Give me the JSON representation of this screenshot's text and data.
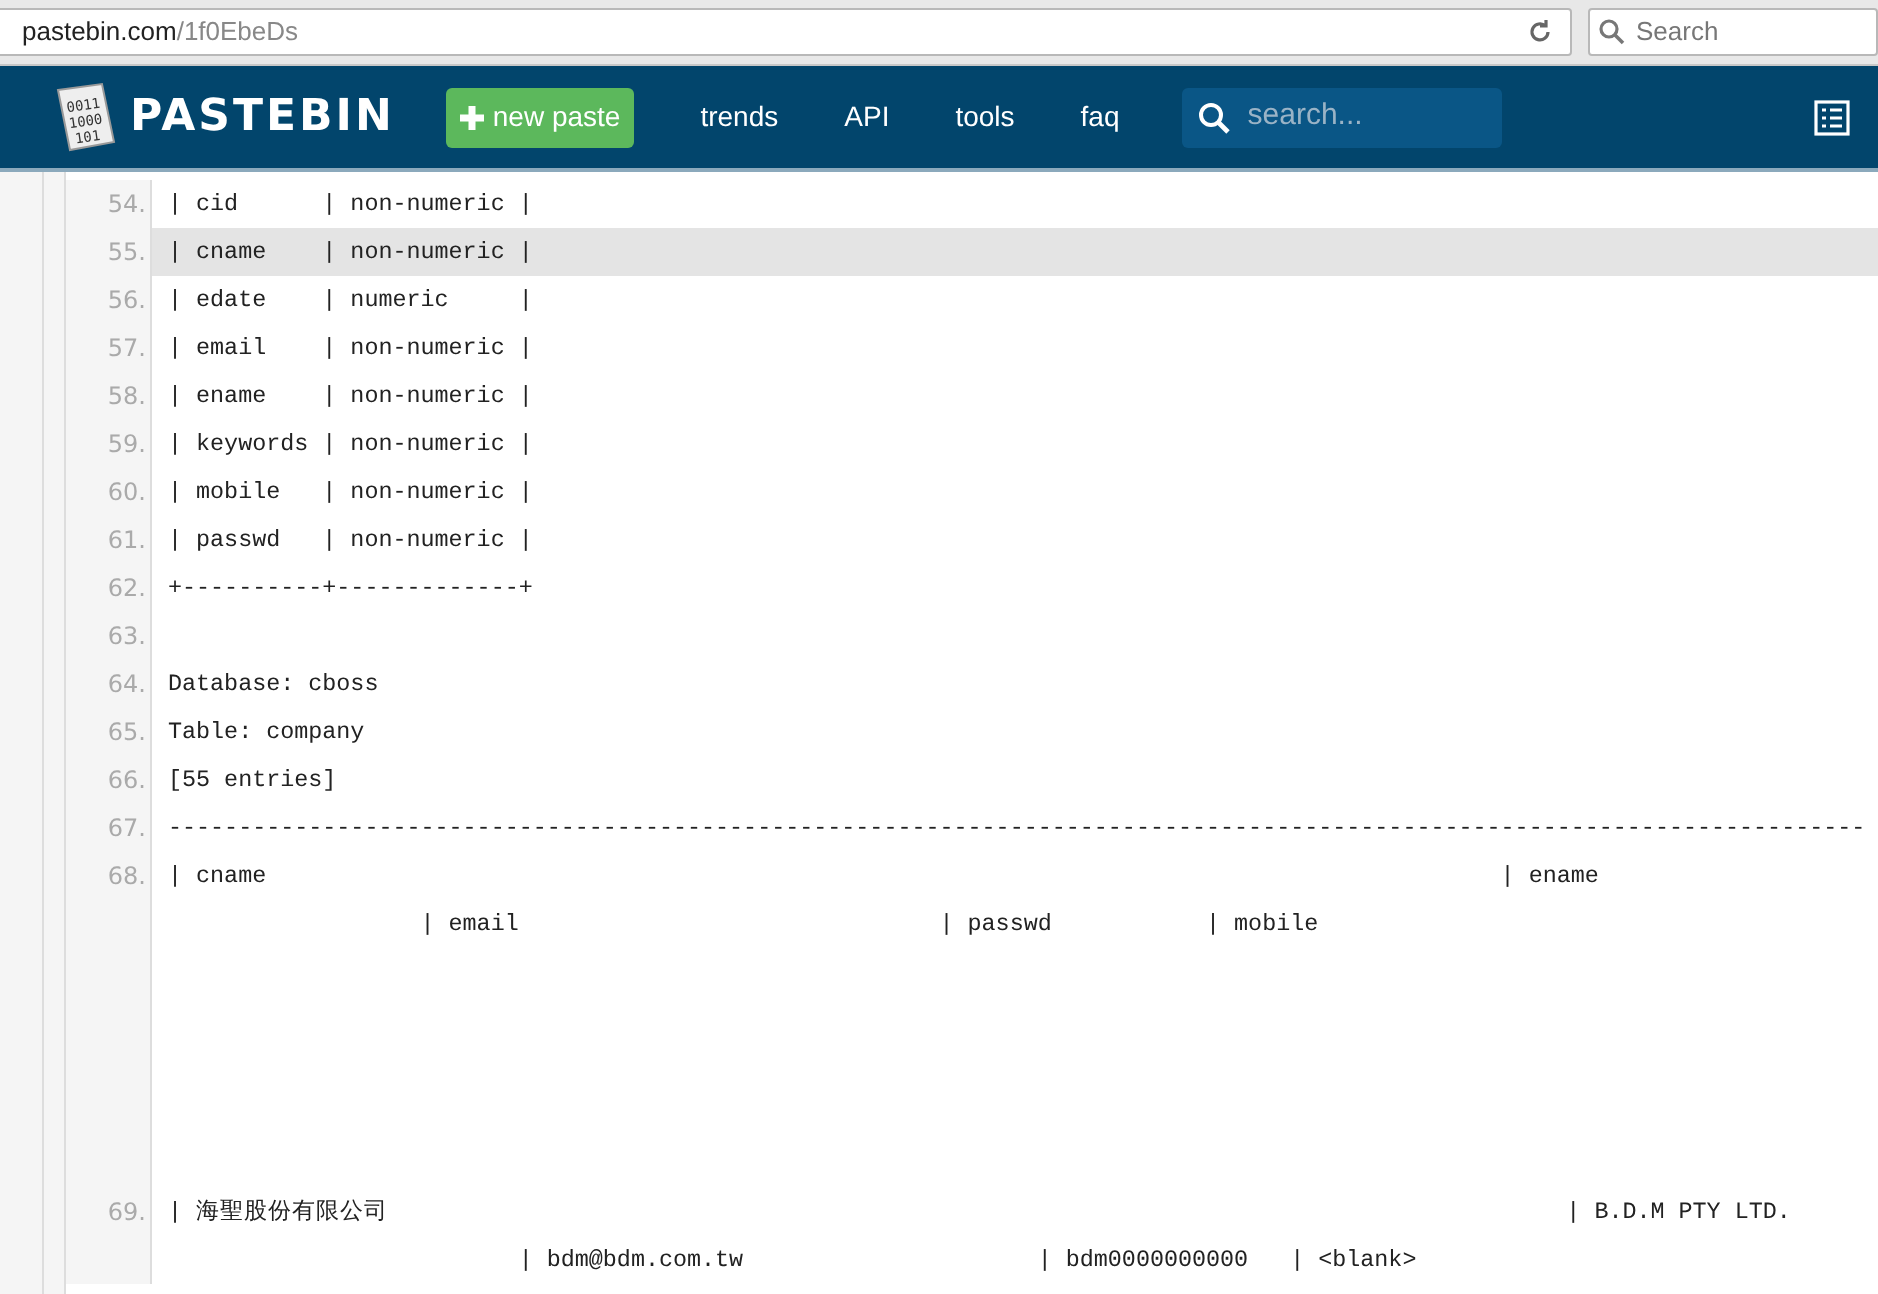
{
  "browser": {
    "url_host": "pastebin.com",
    "url_path": "/1f0EbeDs",
    "search_placeholder": "Search"
  },
  "nav": {
    "logo_text": "PASTEBIN",
    "logo_digits": "0011 1000 101",
    "new_paste": "new paste",
    "links": [
      "trends",
      "API",
      "tools",
      "faq"
    ],
    "search_placeholder": "search..."
  },
  "lines": [
    {
      "number": "54.",
      "highlighted": false,
      "rows": [
        "| cid      | non-numeric |"
      ]
    },
    {
      "number": "55.",
      "highlighted": true,
      "rows": [
        "| cname    | non-numeric |"
      ]
    },
    {
      "number": "56.",
      "highlighted": false,
      "rows": [
        "| edate    | numeric     |"
      ]
    },
    {
      "number": "57.",
      "highlighted": false,
      "rows": [
        "| email    | non-numeric |"
      ]
    },
    {
      "number": "58.",
      "highlighted": false,
      "rows": [
        "| ename    | non-numeric |"
      ]
    },
    {
      "number": "59.",
      "highlighted": false,
      "rows": [
        "| keywords | non-numeric |"
      ]
    },
    {
      "number": "60.",
      "highlighted": false,
      "rows": [
        "| mobile   | non-numeric |"
      ]
    },
    {
      "number": "61.",
      "highlighted": false,
      "rows": [
        "| passwd   | non-numeric |"
      ]
    },
    {
      "number": "62.",
      "highlighted": false,
      "rows": [
        "+----------+-------------+"
      ]
    },
    {
      "number": "63.",
      "highlighted": false
    },
    {
      "number": "64.",
      "highlighted": false,
      "rows": [
        "Database: cboss"
      ]
    },
    {
      "number": "65.",
      "highlighted": false,
      "rows": [
        "Table: company"
      ]
    },
    {
      "number": "66.",
      "highlighted": false,
      "rows": [
        "[55 entries]"
      ]
    },
    {
      "number": "67.",
      "highlighted": false,
      "rows": [
        "-------------------------------------------------------------------------------------------------------------------------"
      ]
    },
    {
      "number": "68.",
      "highlighted": false,
      "rows": [
        "| cname                                                                                        | ename",
        "                  | email                              | passwd           | mobile"
      ],
      "tall": true
    },
    {
      "number": "69.",
      "highlighted": false,
      "rows": [
        "| 海聖股份有限公司                                                                                    | B.D.M PTY LTD.",
        "                         | bdm@bdm.com.tw                     | bdm0000000000   | <blank>"
      ]
    }
  ]
}
